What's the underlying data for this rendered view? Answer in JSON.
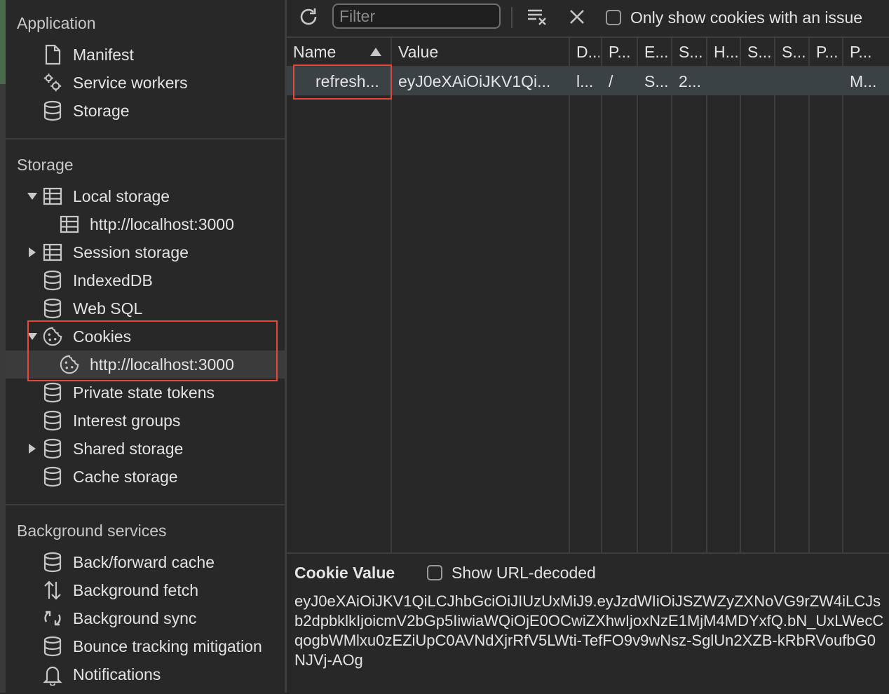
{
  "sidebar": {
    "application": {
      "heading": "Application",
      "items": [
        {
          "label": "Manifest",
          "icon": "document-icon"
        },
        {
          "label": "Service workers",
          "icon": "gears-icon"
        },
        {
          "label": "Storage",
          "icon": "database-icon"
        }
      ]
    },
    "storage": {
      "heading": "Storage",
      "items": [
        {
          "label": "Local storage",
          "icon": "table-icon",
          "expanded": true
        },
        {
          "label": "http://localhost:3000",
          "icon": "table-icon"
        },
        {
          "label": "Session storage",
          "icon": "table-icon",
          "expanded": false
        },
        {
          "label": "IndexedDB",
          "icon": "database-icon"
        },
        {
          "label": "Web SQL",
          "icon": "database-icon"
        },
        {
          "label": "Cookies",
          "icon": "cookie-icon",
          "expanded": true
        },
        {
          "label": "http://localhost:3000",
          "icon": "cookie-icon",
          "selected": true
        },
        {
          "label": "Private state tokens",
          "icon": "database-icon"
        },
        {
          "label": "Interest groups",
          "icon": "database-icon"
        },
        {
          "label": "Shared storage",
          "icon": "database-icon",
          "expanded": false
        },
        {
          "label": "Cache storage",
          "icon": "database-icon"
        }
      ]
    },
    "background": {
      "heading": "Background services",
      "items": [
        {
          "label": "Back/forward cache",
          "icon": "database-icon"
        },
        {
          "label": "Background fetch",
          "icon": "up-down-arrows-icon"
        },
        {
          "label": "Background sync",
          "icon": "sync-icon"
        },
        {
          "label": "Bounce tracking mitigation",
          "icon": "database-icon"
        },
        {
          "label": "Notifications",
          "icon": "bell-icon"
        }
      ]
    }
  },
  "toolbar": {
    "refresh_icon": "refresh-icon",
    "filter_placeholder": "Filter",
    "clear_filtered_icon": "clear-filtered-icon",
    "clear_all_icon": "close-icon",
    "only_issues_label": "Only show cookies with an issue",
    "only_issues_checked": false
  },
  "table": {
    "columns": [
      "Name",
      "Value",
      "D...",
      "P...",
      "E...",
      "S...",
      "H...",
      "S...",
      "S...",
      "P...",
      "P..."
    ],
    "sort_column": "Name",
    "sort_direction": "ascending",
    "rows": [
      [
        "refresh...",
        "eyJ0eXAiOiJKV1Qi...",
        "l...",
        "/",
        "S...",
        "2...",
        "",
        "",
        "",
        "",
        "M..."
      ]
    ]
  },
  "details": {
    "title": "Cookie Value",
    "show_decoded_label": "Show URL-decoded",
    "show_decoded_checked": false,
    "value": "eyJ0eXAiOiJKV1QiLCJhbGciOiJIUzUxMiJ9.eyJzdWIiOiJSZWZyZXNoVG9rZW4iLCJsb2dpbklkIjoicmV2bGp5IiwiaWQiOjE0OCwiZXhwIjoxNzE1MjM4MDYxfQ.bN_UxLWecCqogbWMlxu0zEZiUpC0AVNdXjrRfV5LWti-TefFO9v9wNsz-SglUn2XZB-kRbRVoufbG0NJVj-AOg"
  },
  "colors": {
    "background": "#282828",
    "selected_row": "#3b4246",
    "highlight": "#e5463a"
  }
}
